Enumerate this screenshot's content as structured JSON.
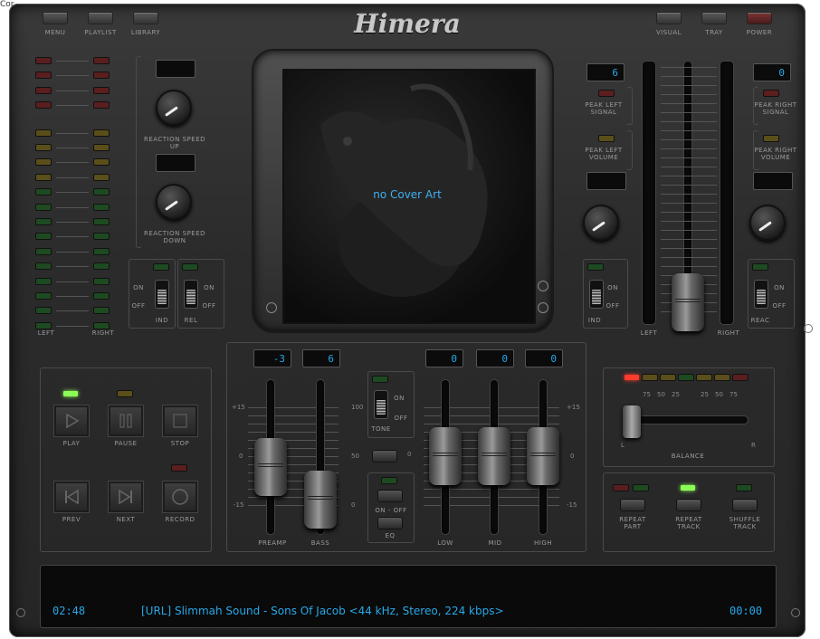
{
  "title_bar": {
    "left_text": "Cor"
  },
  "skin": {
    "title": "Himera"
  },
  "top_menu": {
    "menu": "MENU",
    "playlist": "PLAYLIST",
    "library": "LIBRARY"
  },
  "top_right": {
    "visual": "VISUAL",
    "tray": "TRAY",
    "power": "POWER"
  },
  "left_meter": {
    "left": "LEFT",
    "right": "RIGHT"
  },
  "reaction": {
    "speed_up": "REACTION SPEED UP",
    "speed_down": "REACTION SPEED DOWN"
  },
  "switches_left": {
    "on": "ON",
    "off": "OFF",
    "ind": "IND",
    "rel": "REL"
  },
  "cover": {
    "text": "no Cover Art"
  },
  "right_section": {
    "lcd_left": "6",
    "lcd_right": "0",
    "peak_left_signal": "PEAK LEFT SIGNAL",
    "peak_left_volume": "PEAK LEFT VOLUME",
    "peak_right_signal": "PEAK RIGHT SIGNAL",
    "peak_right_volume": "PEAK RIGHT VOLUME",
    "left": "LEFT",
    "right": "RIGHT",
    "ind": "IND",
    "reac": "REAC",
    "on": "ON",
    "off": "OFF"
  },
  "transport": {
    "play": "PLAY",
    "pause": "PAUSE",
    "stop": "STOP",
    "prev": "PREV",
    "next": "NEXT",
    "record": "RECORD"
  },
  "eq": {
    "preamp_value": "-3",
    "bass_value": "6",
    "low_value": "0",
    "mid_value": "0",
    "high_value": "0",
    "preamp": "PREAMP",
    "bass": "BASS",
    "low": "LOW",
    "mid": "MID",
    "high": "HIGH",
    "tone": "TONE",
    "on": "ON",
    "off": "OFF",
    "eq_label": "EQ",
    "on_off": "ON - OFF",
    "scale_p15": "+15",
    "scale_0": "0",
    "scale_m15": "-15",
    "scale_100": "100",
    "scale_50": "50",
    "scale_b0": "0",
    "zero_label": "0"
  },
  "balance": {
    "label": "BALANCE",
    "l": "L",
    "r": "R",
    "scale": [
      "75",
      "50",
      "25",
      "",
      "25",
      "50",
      "75"
    ]
  },
  "repeat": {
    "repeat_part": "REPEAT PART",
    "repeat_track": "REPEAT TRACK",
    "shuffle_track": "SHUFFLE TRACK"
  },
  "status": {
    "time_left": "02:48",
    "track": "[URL] Slimmah Sound - Sons Of Jacob <44 kHz, Stereo, 224 kbps>",
    "time_right": "00:00"
  },
  "colors": {
    "accent": "#28a8e8",
    "led_green": "#8cff56",
    "led_red": "#ff3b2b"
  },
  "icons": [
    "play-icon",
    "pause-icon",
    "stop-icon",
    "prev-icon",
    "next-icon",
    "record-icon",
    "dragon-art"
  ]
}
